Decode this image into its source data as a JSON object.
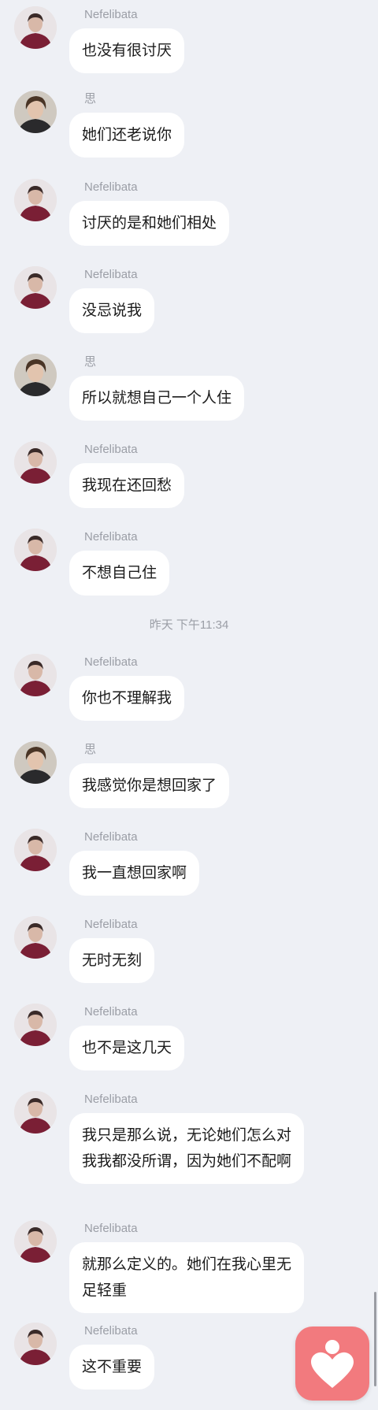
{
  "colors": {
    "background": "#eef0f5",
    "bubble": "#ffffff",
    "name_text": "#9b9ea6",
    "fab": "#f27a7e"
  },
  "users": {
    "nefelibata": {
      "name": "Nefelibata",
      "avatar_icon": "portrait-dark-red-sweater"
    },
    "si": {
      "name": "思",
      "avatar_icon": "portrait-boy-dark-shirt"
    }
  },
  "messages": [
    {
      "sender": "Nefelibata",
      "text": "也没有很讨厌"
    },
    {
      "sender": "思",
      "text": "她们还老说你"
    },
    {
      "sender": "Nefelibata",
      "text": "讨厌的是和她们相处"
    },
    {
      "sender": "Nefelibata",
      "text": "没忌说我"
    },
    {
      "sender": "思",
      "text": "所以就想自己一个人住"
    },
    {
      "sender": "Nefelibata",
      "text": "我现在还回愁"
    },
    {
      "sender": "Nefelibata",
      "text": "不想自己住"
    },
    {
      "sender": "Nefelibata",
      "text": "你也不理解我"
    },
    {
      "sender": "思",
      "text": "我感觉你是想回家了"
    },
    {
      "sender": "Nefelibata",
      "text": "我一直想回家啊"
    },
    {
      "sender": "Nefelibata",
      "text": "无时无刻"
    },
    {
      "sender": "Nefelibata",
      "text": "也不是这几天"
    },
    {
      "sender": "Nefelibata",
      "text": "我只是那么说，无论她们怎么对我我都没所谓，因为她们不配啊"
    },
    {
      "sender": "Nefelibata",
      "text": "就那么定义的。她们在我心里无足轻重"
    },
    {
      "sender": "Nefelibata",
      "text": "这不重要"
    }
  ],
  "timestamp": "昨天 下午11:34",
  "fab": {
    "icon": "heart-person-icon"
  }
}
